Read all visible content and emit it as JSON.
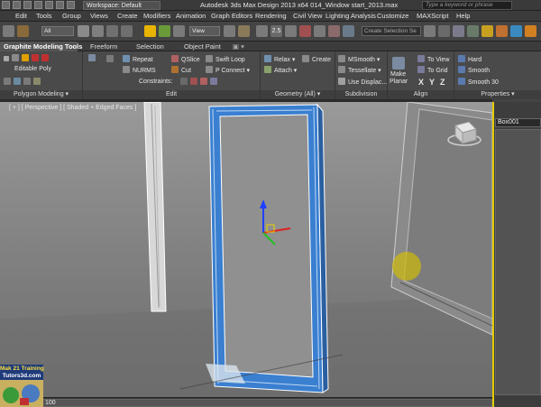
{
  "titlebar": {
    "workspace": "Workspace: Default",
    "title": "Autodesk 3ds Max Design 2013 x64      014_Window start_2013.max",
    "search_placeholder": "Type a keyword or phrase"
  },
  "menu": [
    "Edit",
    "Tools",
    "Group",
    "Views",
    "Create",
    "Modifiers",
    "Animation",
    "Graph Editors",
    "Rendering",
    "Civil View",
    "Lighting Analysis",
    "Customize",
    "MAXScript",
    "Help"
  ],
  "toolbar": {
    "selection_filter": "All",
    "ref_coord": "View",
    "snap_value": "2.5",
    "create_selection_set": "Create Selection Se"
  },
  "ribbon_tabs": [
    "Graphite Modeling Tools",
    "Freeform",
    "Selection",
    "Object Paint"
  ],
  "ribbon": {
    "polygon_modeling": {
      "label": "Editable Poly",
      "title": "Polygon Modeling ▾"
    },
    "edit": {
      "repeat": "Repeat",
      "quickslice": "QSlice",
      "swift_loop": "Swift Loop",
      "nurms": "NURMS",
      "cut": "Cut",
      "p_connect": "P Connect ▾",
      "constraints": "Constraints:",
      "title": "Edit"
    },
    "geometry": {
      "relax": "Relax ▾",
      "create": "Create",
      "attach": "Attach ▾",
      "title": "Geometry (All) ▾"
    },
    "subdivision": {
      "msmooth": "MSmooth ▾",
      "tessellate": "Tessellate ▾",
      "use_displace": "Use Displac...",
      "title": "Subdivision"
    },
    "align": {
      "make_planar_1": "Make",
      "make_planar_2": "Planar",
      "to_view": "To View",
      "to_grid": "To Grid",
      "x": "X",
      "y": "Y",
      "z": "Z",
      "title": "Align"
    },
    "properties": {
      "hard": "Hard",
      "smooth": "Smooth",
      "smooth30": "Smooth 30",
      "title": "Properties ▾"
    }
  },
  "viewport": {
    "label": "[ + ] [ Perspective ] [ Shaded + Edged Faces ]"
  },
  "command_panel": {
    "object_name": "Box001"
  },
  "statusbar": {
    "frame": "100"
  },
  "watermark": {
    "line1": "Mak 21 Training",
    "line2": "Tutors3d.com"
  },
  "colors": {
    "accent": "#e4cc00",
    "selection_blue": "#3a7fd0",
    "background": "#2b2b2b"
  }
}
